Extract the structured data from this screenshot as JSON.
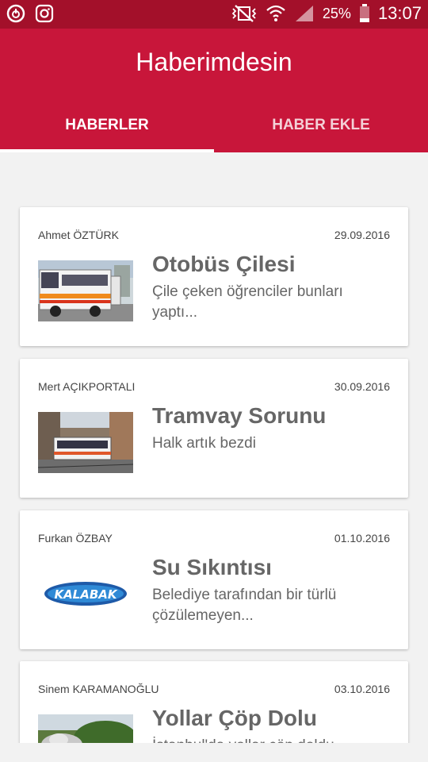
{
  "status_bar": {
    "battery": "25%",
    "time": "13:07",
    "icons": [
      "power-saver-icon",
      "instagram-icon",
      "vibrate-icon",
      "wifi-icon",
      "signal-icon",
      "battery-icon"
    ]
  },
  "app": {
    "title": "Haberimdesin",
    "colors": {
      "primary": "#c8163a",
      "status": "#a3102a"
    }
  },
  "tabs": [
    {
      "label": "HABERLER",
      "active": true
    },
    {
      "label": "HABER EKLE",
      "active": false
    }
  ],
  "news": [
    {
      "author": "Ahmet ÖZTÜRK",
      "date": "29.09.2016",
      "title": "Otobüs Çilesi",
      "summary": "Çile çeken öğrenciler bunları yaptı...",
      "thumb": "bus-photo"
    },
    {
      "author": "Mert AÇIKPORTALI",
      "date": "30.09.2016",
      "title": "Tramvay Sorunu",
      "summary": "Halk artık bezdi",
      "thumb": "tram-photo"
    },
    {
      "author": "Furkan ÖZBAY",
      "date": "01.10.2016",
      "title": "Su Sıkıntısı",
      "summary": "Belediye tarafından bir türlü çözülemeyen...",
      "thumb": "kalabak-logo",
      "thumb_text": "KALABAK"
    },
    {
      "author": "Sinem KARAMANOĞLU",
      "date": "03.10.2016",
      "title": "Yollar Çöp Dolu",
      "summary": "İstanbul'da yollar çöp doldu...",
      "thumb": "garbage-photo"
    }
  ]
}
